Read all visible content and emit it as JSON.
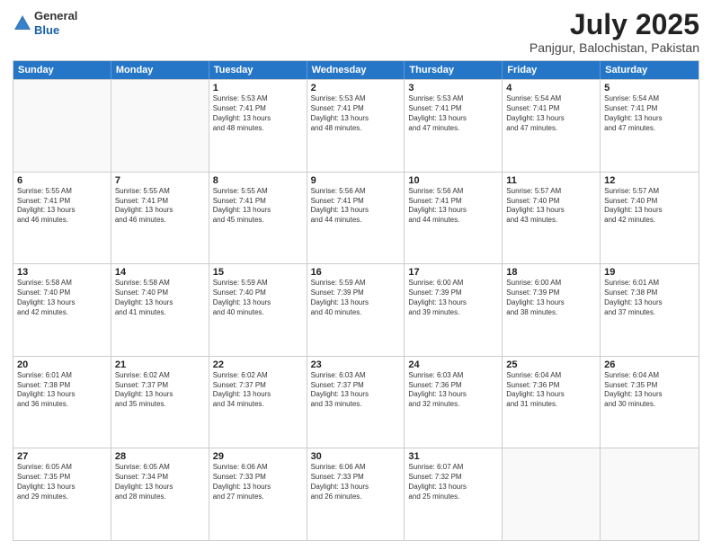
{
  "header": {
    "logo_general": "General",
    "logo_blue": "Blue",
    "month_year": "July 2025",
    "location": "Panjgur, Balochistan, Pakistan"
  },
  "weekdays": [
    "Sunday",
    "Monday",
    "Tuesday",
    "Wednesday",
    "Thursday",
    "Friday",
    "Saturday"
  ],
  "rows": [
    [
      {
        "day": "",
        "info": ""
      },
      {
        "day": "",
        "info": ""
      },
      {
        "day": "1",
        "info": "Sunrise: 5:53 AM\nSunset: 7:41 PM\nDaylight: 13 hours\nand 48 minutes."
      },
      {
        "day": "2",
        "info": "Sunrise: 5:53 AM\nSunset: 7:41 PM\nDaylight: 13 hours\nand 48 minutes."
      },
      {
        "day": "3",
        "info": "Sunrise: 5:53 AM\nSunset: 7:41 PM\nDaylight: 13 hours\nand 47 minutes."
      },
      {
        "day": "4",
        "info": "Sunrise: 5:54 AM\nSunset: 7:41 PM\nDaylight: 13 hours\nand 47 minutes."
      },
      {
        "day": "5",
        "info": "Sunrise: 5:54 AM\nSunset: 7:41 PM\nDaylight: 13 hours\nand 47 minutes."
      }
    ],
    [
      {
        "day": "6",
        "info": "Sunrise: 5:55 AM\nSunset: 7:41 PM\nDaylight: 13 hours\nand 46 minutes."
      },
      {
        "day": "7",
        "info": "Sunrise: 5:55 AM\nSunset: 7:41 PM\nDaylight: 13 hours\nand 46 minutes."
      },
      {
        "day": "8",
        "info": "Sunrise: 5:55 AM\nSunset: 7:41 PM\nDaylight: 13 hours\nand 45 minutes."
      },
      {
        "day": "9",
        "info": "Sunrise: 5:56 AM\nSunset: 7:41 PM\nDaylight: 13 hours\nand 44 minutes."
      },
      {
        "day": "10",
        "info": "Sunrise: 5:56 AM\nSunset: 7:41 PM\nDaylight: 13 hours\nand 44 minutes."
      },
      {
        "day": "11",
        "info": "Sunrise: 5:57 AM\nSunset: 7:40 PM\nDaylight: 13 hours\nand 43 minutes."
      },
      {
        "day": "12",
        "info": "Sunrise: 5:57 AM\nSunset: 7:40 PM\nDaylight: 13 hours\nand 42 minutes."
      }
    ],
    [
      {
        "day": "13",
        "info": "Sunrise: 5:58 AM\nSunset: 7:40 PM\nDaylight: 13 hours\nand 42 minutes."
      },
      {
        "day": "14",
        "info": "Sunrise: 5:58 AM\nSunset: 7:40 PM\nDaylight: 13 hours\nand 41 minutes."
      },
      {
        "day": "15",
        "info": "Sunrise: 5:59 AM\nSunset: 7:40 PM\nDaylight: 13 hours\nand 40 minutes."
      },
      {
        "day": "16",
        "info": "Sunrise: 5:59 AM\nSunset: 7:39 PM\nDaylight: 13 hours\nand 40 minutes."
      },
      {
        "day": "17",
        "info": "Sunrise: 6:00 AM\nSunset: 7:39 PM\nDaylight: 13 hours\nand 39 minutes."
      },
      {
        "day": "18",
        "info": "Sunrise: 6:00 AM\nSunset: 7:39 PM\nDaylight: 13 hours\nand 38 minutes."
      },
      {
        "day": "19",
        "info": "Sunrise: 6:01 AM\nSunset: 7:38 PM\nDaylight: 13 hours\nand 37 minutes."
      }
    ],
    [
      {
        "day": "20",
        "info": "Sunrise: 6:01 AM\nSunset: 7:38 PM\nDaylight: 13 hours\nand 36 minutes."
      },
      {
        "day": "21",
        "info": "Sunrise: 6:02 AM\nSunset: 7:37 PM\nDaylight: 13 hours\nand 35 minutes."
      },
      {
        "day": "22",
        "info": "Sunrise: 6:02 AM\nSunset: 7:37 PM\nDaylight: 13 hours\nand 34 minutes."
      },
      {
        "day": "23",
        "info": "Sunrise: 6:03 AM\nSunset: 7:37 PM\nDaylight: 13 hours\nand 33 minutes."
      },
      {
        "day": "24",
        "info": "Sunrise: 6:03 AM\nSunset: 7:36 PM\nDaylight: 13 hours\nand 32 minutes."
      },
      {
        "day": "25",
        "info": "Sunrise: 6:04 AM\nSunset: 7:36 PM\nDaylight: 13 hours\nand 31 minutes."
      },
      {
        "day": "26",
        "info": "Sunrise: 6:04 AM\nSunset: 7:35 PM\nDaylight: 13 hours\nand 30 minutes."
      }
    ],
    [
      {
        "day": "27",
        "info": "Sunrise: 6:05 AM\nSunset: 7:35 PM\nDaylight: 13 hours\nand 29 minutes."
      },
      {
        "day": "28",
        "info": "Sunrise: 6:05 AM\nSunset: 7:34 PM\nDaylight: 13 hours\nand 28 minutes."
      },
      {
        "day": "29",
        "info": "Sunrise: 6:06 AM\nSunset: 7:33 PM\nDaylight: 13 hours\nand 27 minutes."
      },
      {
        "day": "30",
        "info": "Sunrise: 6:06 AM\nSunset: 7:33 PM\nDaylight: 13 hours\nand 26 minutes."
      },
      {
        "day": "31",
        "info": "Sunrise: 6:07 AM\nSunset: 7:32 PM\nDaylight: 13 hours\nand 25 minutes."
      },
      {
        "day": "",
        "info": ""
      },
      {
        "day": "",
        "info": ""
      }
    ]
  ]
}
